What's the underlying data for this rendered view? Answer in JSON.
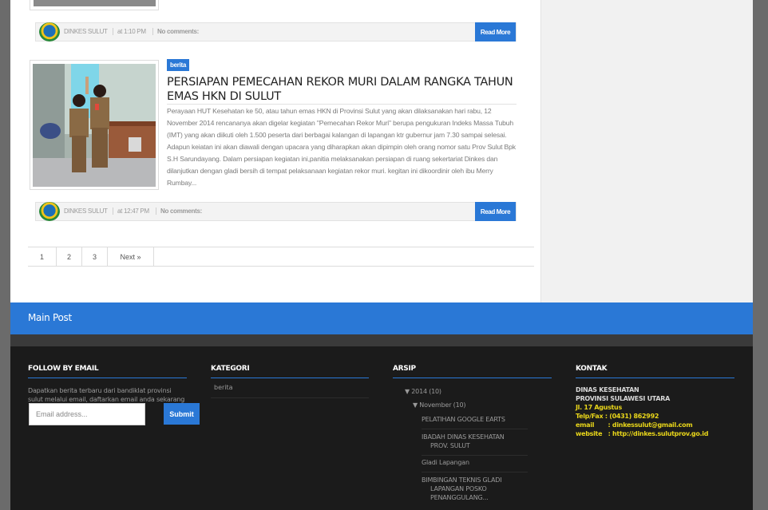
{
  "post_meta": {
    "author": "DINKES SULUT",
    "comments": "No comments:",
    "read_more": "Read More",
    "time_prev": "at 1:10 PM",
    "time_current": "at 12:47 PM"
  },
  "post": {
    "label": "berita",
    "title": "PERSIAPAN PEMECAHAN REKOR MURI DALAM RANGKA TAHUN EMAS HKN DI SULUT",
    "excerpt": "Perayaan HUT Kesehatan ke 50, atau tahun emas HKN di Provinsi Sulut yang akan dilaksanakan hari rabu, 12 November 2014 rencananya akan digelar kegiatan \"Pemecahan Rekor Muri\" berupa  pengukuran Indeks Massa Tubuh (IMT) yang akan diikuti oleh 1.500 peserta dari berbagai kalangan di lapangan ktr gubernur jam 7.30 sampai selesai. Adapun keiatan ini  akan diawali dengan upacara yang diharapkan akan dipimpin oleh orang nomor satu Prov Sulut Bpk S.H Sarundayang. Dalam persiapan kegiatan ini,panitia melaksanakan  persiapan di ruang sekertariat Dinkes  dan dilanjutkan dengan  gladi bersih di tempat pelaksanaan kegiatan rekor muri. kegitan ini dikoordinir oleh ibu Merry Rumbay..."
  },
  "pagination": [
    "1",
    "2",
    "3",
    "Next »"
  ],
  "blue_bar": {
    "label": "Main Post"
  },
  "footer": {
    "follow": {
      "heading": "FOLLOW BY EMAIL",
      "description": "Dapatkan berita terbaru dari bandiklat provinsi sulut melalui email, daftarkan email anda sekarang",
      "email_placeholder": "Email address...",
      "submit": "Submit"
    },
    "kategori": {
      "heading": "KATEGORI",
      "items": [
        "berita"
      ]
    },
    "arsip": {
      "heading": "ARSIP",
      "year": "2014",
      "year_count": "(10)",
      "month": "November",
      "month_count": "(10)",
      "posts": [
        {
          "line1": "PELATIHAN GOOGLE EARTS",
          "line2": ""
        },
        {
          "line1": "IBADAH DINAS KESEHATAN",
          "line2": "PROV. SULUT"
        },
        {
          "line1": "Gladi Lapangan",
          "line2": ""
        },
        {
          "line1": "BIMBINGAN TEKNIS GLADI",
          "line2": "LAPANGAN POSKO",
          "line3": "PENANGGULANG..."
        }
      ]
    },
    "kontak": {
      "heading": "KONTAK",
      "org1": "DINAS KESEHATAN",
      "org2": "PROVINSI SULAWESI UTARA",
      "address": "Jl. 17 Agustus",
      "telp": "Telp/Fax : (0431) 862992",
      "email": "email       : dinkessulut@gmail.com",
      "website": "website   : http://dinkes.sulutprov.go.id"
    }
  },
  "colors": {
    "accent": "#2a78d6",
    "footer_bg": "#1b1b1b",
    "kontak_yellow": "#e8d51a"
  }
}
